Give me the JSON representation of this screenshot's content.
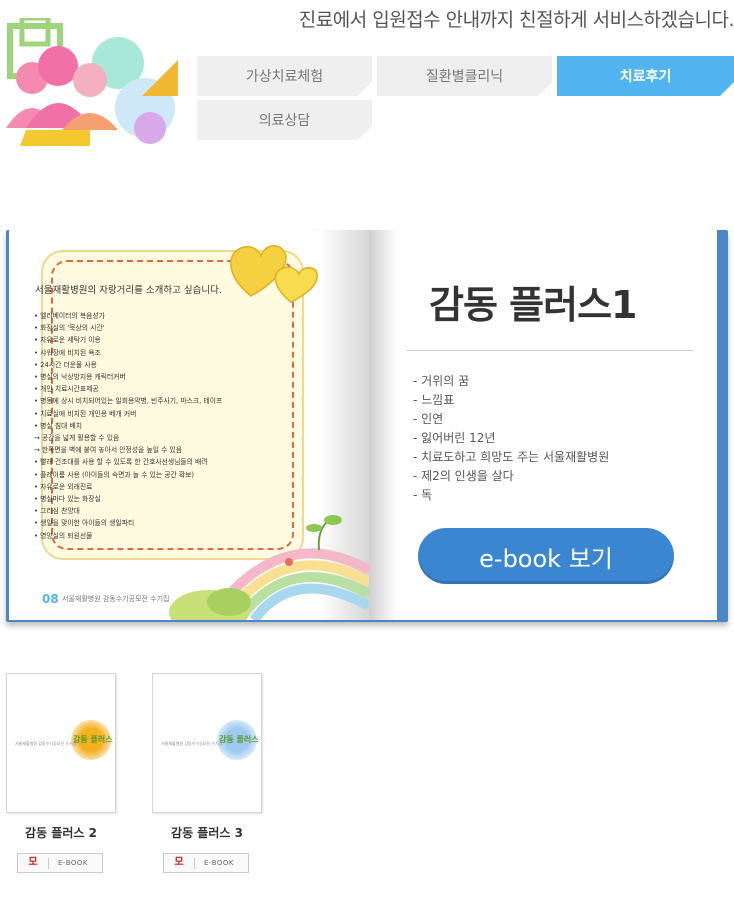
{
  "header": {
    "slogan": "진료에서 입원접수 안내까지 친절하게 서비스하겠습니다."
  },
  "tabs": [
    {
      "label": "가상치료체험",
      "active": false
    },
    {
      "label": "질환별클리닉",
      "active": false
    },
    {
      "label": "치료후기",
      "active": true
    },
    {
      "label": "의료상담",
      "active": false
    }
  ],
  "book": {
    "left_page": {
      "note_title": "서울재활병원의 자랑거리를 소개하고 싶습니다.",
      "items": [
        "• 엘리베이터의 복음성가",
        "• 화장실의 '묵상의 시간'",
        "• 자유로운 세탁기 이용",
        "• 샤워장에 비치된 욕조",
        "• 24시간 더운물 사용",
        "• 병실의 낙상방지용 캐릭터커버",
        "• 개인 치료시간표제공",
        "• 병동에 상시 비치되어있는 일회용약병, 빈주사기, 마스크, 테이프",
        "• 치료실에 비치된 개인용 베개 커버",
        "• 병실 침대 배치",
        "  → 공간을 넓게 활용할 수 있음",
        "  → 한쪽면을 벽에 붙여 놓아서 안정성을 높일 수 있음",
        "• 빨래 건조대를 사용 할 수 있도록 한 간호사선생님들의 배려",
        "• 플레이룸 사용 (아이들의 숙면과 놀 수 있는 공간 확보)",
        "• 자유로운 외래진료",
        "• 병실마다 있는 화장실",
        "• 그리심 찬양대",
        "• 생일을 맞이한 아이들의 생일파티",
        "• 영양실의 퇴원선물"
      ],
      "page_number": "08",
      "caption": "서울재활병원 감동수기공모전 수기집"
    },
    "right_page": {
      "title": "감동 플러스1",
      "chapters": [
        "- 거위의 꿈",
        "- 느낌표",
        "- 인연",
        "- 잃어버린 12년",
        "- 치료도하고 희망도 주는 서울재활병원",
        "- 제2의 인생을 살다",
        "- 독"
      ],
      "button_label": "e-book 보기"
    }
  },
  "thumbnails": [
    {
      "label": "감동 플러스 2",
      "cover_text": "서울재활병원 감동수기공모전 수기집",
      "logo_text": "감동 플러스",
      "button_badge": "모",
      "button_label": "E-BOOK",
      "accent": "#f5b020"
    },
    {
      "label": "감동 플러스 3",
      "cover_text": "서울재활병원 감동수기공모전 수기집",
      "logo_text": "감동 플러스",
      "button_badge": "모",
      "button_label": "E-BOOK",
      "accent": "#7ab8e8"
    }
  ],
  "colors": {
    "tab_active": "#52b4f0",
    "tab_inactive": "#efefef",
    "book_frame": "#4a86c8",
    "ebook_button": "#3a86d0"
  }
}
